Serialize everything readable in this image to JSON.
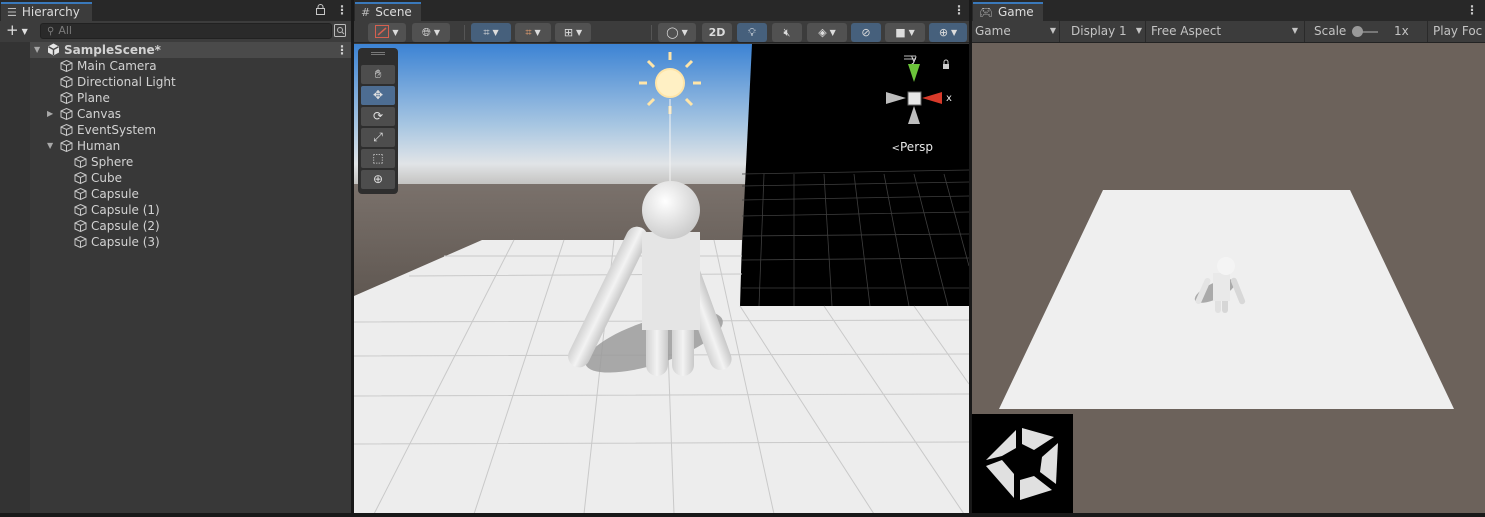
{
  "hierarchy": {
    "tab_label": "Hierarchy",
    "search_placeholder": "All",
    "scene_name": "SampleScene*",
    "items": [
      {
        "label": "Main Camera",
        "depth": 1,
        "expand": ""
      },
      {
        "label": "Directional Light",
        "depth": 1,
        "expand": ""
      },
      {
        "label": "Plane",
        "depth": 1,
        "expand": ""
      },
      {
        "label": "Canvas",
        "depth": 1,
        "expand": "collapsed"
      },
      {
        "label": "EventSystem",
        "depth": 1,
        "expand": ""
      },
      {
        "label": "Human",
        "depth": 1,
        "expand": "expanded"
      },
      {
        "label": "Sphere",
        "depth": 2,
        "expand": ""
      },
      {
        "label": "Cube",
        "depth": 2,
        "expand": ""
      },
      {
        "label": "Capsule",
        "depth": 2,
        "expand": ""
      },
      {
        "label": "Capsule (1)",
        "depth": 2,
        "expand": ""
      },
      {
        "label": "Capsule (2)",
        "depth": 2,
        "expand": ""
      },
      {
        "label": "Capsule (3)",
        "depth": 2,
        "expand": ""
      }
    ]
  },
  "scene": {
    "tab_label": "Scene",
    "mode_2d_label": "2D",
    "projection_label": "Persp",
    "gizmo_axes": {
      "y": "y",
      "x": "x"
    },
    "tools": [
      "hand-tool",
      "move-tool",
      "rotate-tool",
      "scale-tool",
      "rect-tool",
      "transform-tool"
    ],
    "active_tool": "move-tool"
  },
  "game": {
    "tab_label": "Game",
    "view_mode": "Game",
    "display": "Display 1",
    "aspect": "Free Aspect",
    "scale_label": "Scale",
    "scale_value": "1x",
    "play_focus": "Play Foc"
  },
  "colors": {
    "accent_tab": "#3a79bb",
    "panel_bg": "#383838",
    "game_bg": "#6c625b",
    "gizmo_x": "#d83a2a",
    "gizmo_y": "#6cc43a"
  }
}
